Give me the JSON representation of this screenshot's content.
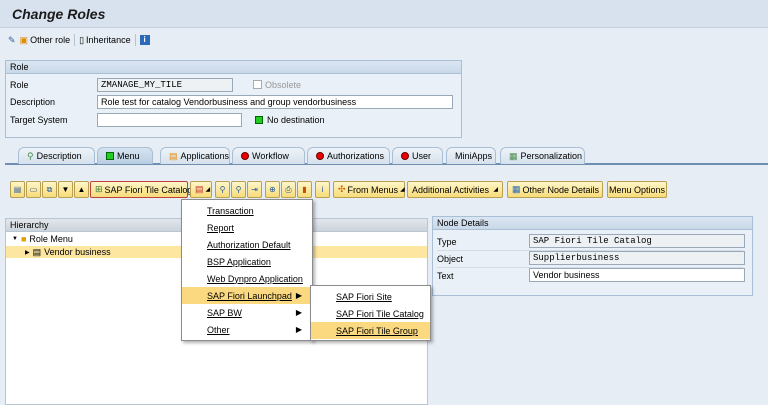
{
  "title": "Change Roles",
  "toolbar": {
    "other_role": "Other role",
    "inheritance": "Inheritance"
  },
  "role_group": {
    "header": "Role",
    "role_label": "Role",
    "role_value": "ZMANAGE_MY_TILE",
    "obsolete_label": "Obsolete",
    "description_label": "Description",
    "description_value": "Role test for catalog Vendorbusiness and group vendorbusiness",
    "target_label": "Target System",
    "target_value": "",
    "destination_status": "No destination"
  },
  "tabs": [
    {
      "label": "Description"
    },
    {
      "label": "Menu"
    },
    {
      "label": "Applications"
    },
    {
      "label": "Workflow"
    },
    {
      "label": "Authorizations"
    },
    {
      "label": "User"
    },
    {
      "label": "MiniApps"
    },
    {
      "label": "Personalization"
    }
  ],
  "menu_toolbar": {
    "dropdown": "SAP Fiori Tile Catalog",
    "from_menus": "From Menus",
    "additional": "Additional Activities",
    "other_node": "Other Node Details",
    "menu_options": "Menu Options"
  },
  "hierarchy": {
    "header": "Hierarchy",
    "root": "Role Menu",
    "child": "Vendor business"
  },
  "node_details": {
    "header": "Node Details",
    "type_label": "Type",
    "type_value": "SAP Fiori Tile Catalog",
    "object_label": "Object",
    "object_value": "Supplierbusiness",
    "text_label": "Text",
    "text_value": "Vendor business"
  },
  "popup": {
    "items": [
      "Transaction",
      "Report",
      "Authorization Default",
      "BSP Application",
      "Web Dynpro Application",
      "SAP Fiori Launchpad",
      "SAP BW",
      "Other"
    ]
  },
  "submenu": {
    "items": [
      "SAP Fiori Site",
      "SAP Fiori Tile Catalog",
      "SAP Fiori Tile Group"
    ]
  },
  "colors": {
    "highlight": "#fbd980",
    "button": "#f8dc7a",
    "status_green": "#22cc22",
    "status_red": "#ee0000"
  }
}
